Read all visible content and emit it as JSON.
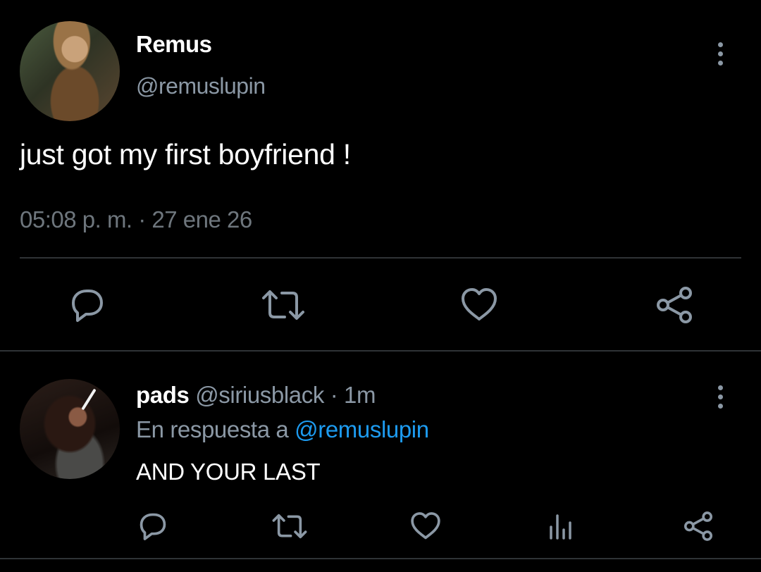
{
  "main_tweet": {
    "display_name": "Remus",
    "handle": "@remuslupin",
    "text": "just got my first boyfriend !",
    "timestamp": "05:08 p. m. · 27 ene 26",
    "actions": [
      "reply-icon",
      "retweet-icon",
      "like-icon",
      "share-icon"
    ]
  },
  "reply_tweet": {
    "display_name": "pads",
    "handle_time": " @siriusblack · 1m",
    "reply_prefix": "En respuesta a ",
    "reply_mention": "@remuslupin",
    "text": "AND YOUR LAST",
    "actions": [
      "reply-icon",
      "retweet-icon",
      "like-icon",
      "analytics-icon",
      "share-icon"
    ]
  },
  "colors": {
    "background": "#000000",
    "primary_text": "#ffffff",
    "secondary_text": "#8b98a5",
    "link": "#1d9bf0",
    "divider": "#2f3336",
    "icon": "#8b98a5"
  }
}
